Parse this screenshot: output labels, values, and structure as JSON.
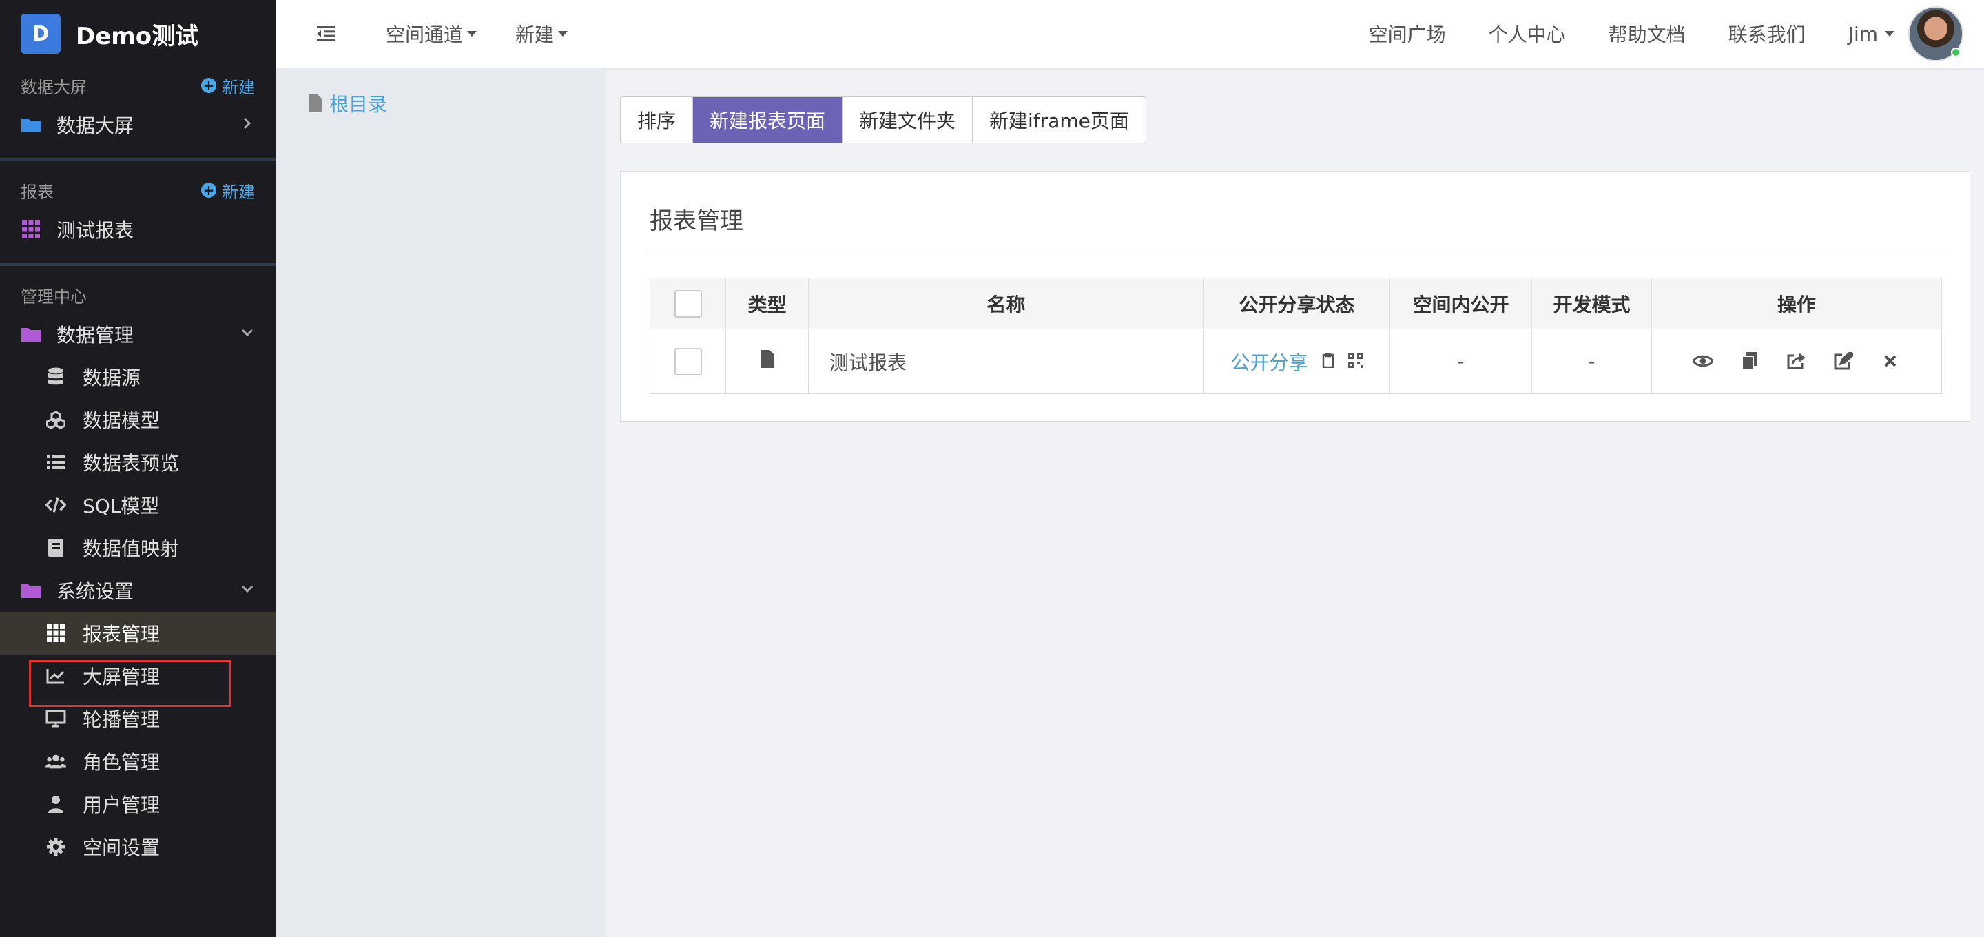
{
  "brand": {
    "logo_letter": "D",
    "name": "Demo测试"
  },
  "sidebar": {
    "screen_section": {
      "title": "数据大屏",
      "new_label": "新建"
    },
    "screen_items": [
      {
        "label": "数据大屏",
        "icon": "folder-icon"
      }
    ],
    "report_section": {
      "title": "报表",
      "new_label": "新建"
    },
    "report_items": [
      {
        "label": "测试报表",
        "icon": "grid-icon"
      }
    ],
    "admin_section": {
      "title": "管理中心"
    },
    "data_mgmt": {
      "label": "数据管理",
      "icon": "folder-icon"
    },
    "data_mgmt_items": [
      {
        "label": "数据源",
        "icon": "database-icon"
      },
      {
        "label": "数据模型",
        "icon": "cubes-icon"
      },
      {
        "label": "数据表预览",
        "icon": "list-icon"
      },
      {
        "label": "SQL模型",
        "icon": "code-icon"
      },
      {
        "label": "数据值映射",
        "icon": "book-icon"
      }
    ],
    "sys_settings": {
      "label": "系统设置",
      "icon": "folder-icon"
    },
    "sys_items": [
      {
        "label": "报表管理",
        "icon": "grid-icon"
      },
      {
        "label": "大屏管理",
        "icon": "chart-icon"
      },
      {
        "label": "轮播管理",
        "icon": "monitor-icon"
      },
      {
        "label": "角色管理",
        "icon": "users-icon"
      },
      {
        "label": "用户管理",
        "icon": "user-icon"
      },
      {
        "label": "空间设置",
        "icon": "gear-icon"
      }
    ]
  },
  "topbar": {
    "menu1": "空间通道",
    "menu2": "新建",
    "links": [
      "空间广场",
      "个人中心",
      "帮助文档",
      "联系我们"
    ],
    "user": "Jim"
  },
  "tree": {
    "root": "根目录"
  },
  "toolbar": {
    "sort": "排序",
    "new_report": "新建报表页面",
    "new_folder": "新建文件夹",
    "new_iframe": "新建iframe页面"
  },
  "panel": {
    "title": "报表管理",
    "headers": {
      "type": "类型",
      "name": "名称",
      "share": "公开分享状态",
      "space": "空间内公开",
      "dev": "开发模式",
      "ops": "操作"
    },
    "rows": [
      {
        "name": "测试报表",
        "share": "公开分享",
        "space": "-",
        "dev": "-"
      }
    ]
  },
  "colors": {
    "primary": "#6c63b7",
    "link": "#4aa0d8",
    "sidebar_bg": "#1b1b20",
    "highlight": "#e0332f"
  }
}
